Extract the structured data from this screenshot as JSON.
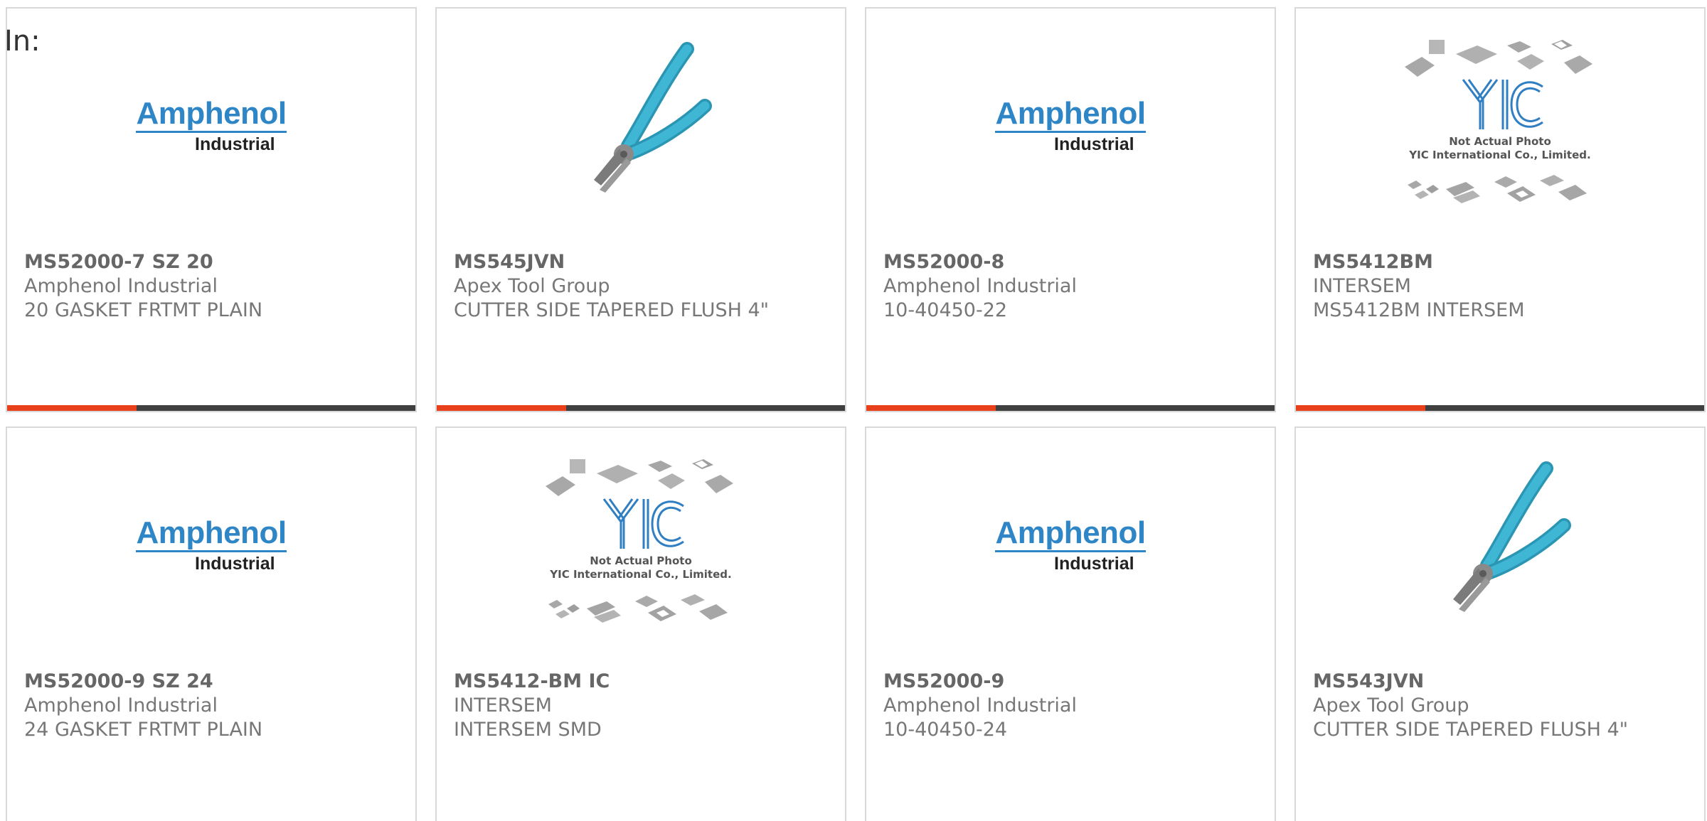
{
  "page": {
    "in_label": "In:"
  },
  "colors": {
    "accent": "#e8401a",
    "bar": "#3f3f3f",
    "amphenol_blue": "#2f86c6",
    "plier_handle": "#3aaecb"
  },
  "logos": {
    "amphenol": {
      "brand": "Amphenol",
      "sub": "Industrial"
    },
    "yic": {
      "line1": "Not Actual Photo",
      "line2": "YIC International Co., Limited."
    }
  },
  "products": [
    {
      "part_number": "MS52000-7 SZ 20",
      "manufacturer": "Amphenol Industrial",
      "description": "20 GASKET FRTMT PLAIN",
      "image": "amphenol-logo"
    },
    {
      "part_number": "MS545JVN",
      "manufacturer": "Apex Tool Group",
      "description": "CUTTER SIDE TAPERED FLUSH 4\"",
      "image": "plier-icon"
    },
    {
      "part_number": "MS52000-8",
      "manufacturer": "Amphenol Industrial",
      "description": "10-40450-22",
      "image": "amphenol-logo"
    },
    {
      "part_number": "MS5412BM",
      "manufacturer": "INTERSEM",
      "description": "MS5412BM INTERSEM",
      "image": "yic-placeholder"
    },
    {
      "part_number": "MS52000-9 SZ 24",
      "manufacturer": "Amphenol Industrial",
      "description": "24 GASKET FRTMT PLAIN",
      "image": "amphenol-logo"
    },
    {
      "part_number": "MS5412-BM IC",
      "manufacturer": "INTERSEM",
      "description": "INTERSEM SMD",
      "image": "yic-placeholder"
    },
    {
      "part_number": "MS52000-9",
      "manufacturer": "Amphenol Industrial",
      "description": "10-40450-24",
      "image": "amphenol-logo"
    },
    {
      "part_number": "MS543JVN",
      "manufacturer": "Apex Tool Group",
      "description": "CUTTER SIDE TAPERED FLUSH 4\"",
      "image": "plier-icon"
    }
  ]
}
